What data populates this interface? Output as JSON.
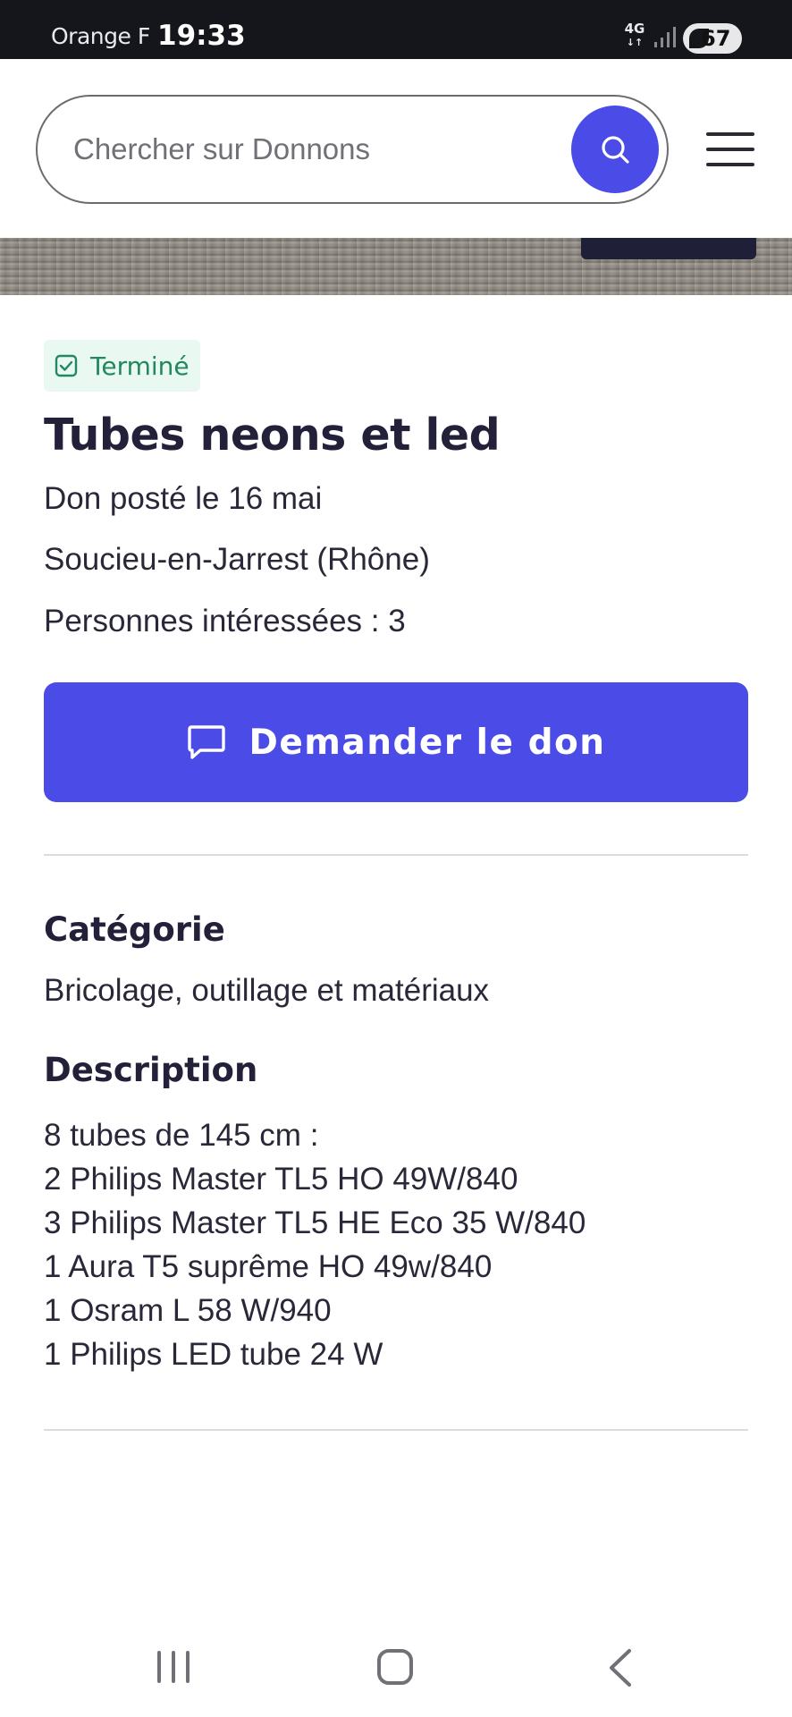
{
  "status_bar": {
    "carrier": "Orange F",
    "time": "19:33",
    "network": "4G",
    "battery": "67"
  },
  "header": {
    "search": {
      "placeholder": "Chercher sur Donnons"
    },
    "icons": {
      "search": "search-icon",
      "menu": "hamburger-menu-icon"
    }
  },
  "listing": {
    "status": "Terminé",
    "title": "Tubes neons et led",
    "posted": "Don posté le 16 mai",
    "location": "Soucieu-en-Jarrest (Rhône)",
    "interested": "Personnes intéressées : 3",
    "cta_label": "Demander le don",
    "category_heading": "Catégorie",
    "category": "Bricolage, outillage et matériaux",
    "description_heading": "Description",
    "description_lines": [
      "8 tubes de 145 cm :",
      "2 Philips Master TL5 HO 49W/840",
      "3 Philips Master TL5 HE Eco 35 W/840",
      "1 Aura T5 suprême HO 49w/840",
      "1 Osram L 58 W/940",
      "1 Philips LED tube 24 W"
    ]
  },
  "colors": {
    "accent": "#4b4be8",
    "status_green": "#21885f",
    "status_bg": "#e9f8f1",
    "text_dark": "#23213a"
  },
  "nav": {
    "icons": [
      "recent-apps-icon",
      "home-icon",
      "back-icon"
    ]
  }
}
